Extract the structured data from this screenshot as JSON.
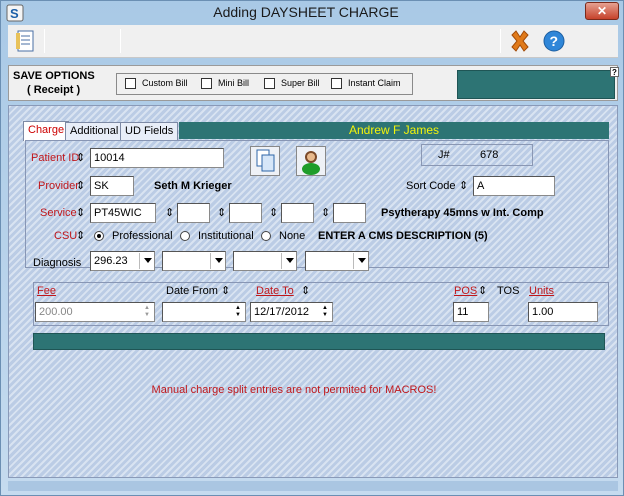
{
  "window": {
    "title": "Adding DAYSHEET CHARGE",
    "close_label": "✕"
  },
  "toolbar": {
    "buttons": [
      "document-icon",
      "cancel-icon",
      "help-icon"
    ]
  },
  "save_options": {
    "title": "SAVE OPTIONS",
    "subtitle": "( Receipt )",
    "checks": [
      {
        "label": "Custom Bill",
        "checked": false
      },
      {
        "label": "Mini Bill",
        "checked": false
      },
      {
        "label": "Super Bill",
        "checked": false
      },
      {
        "label": "Instant Claim",
        "checked": false
      }
    ],
    "help_label": "?"
  },
  "tabs": [
    "Charge",
    "Additional",
    "UD Fields"
  ],
  "patient_name": "Andrew F James",
  "form": {
    "patient_id_label": "Patient ID",
    "patient_id": "10014",
    "j_label": "J#",
    "j_value": "678",
    "provider_label": "Provider",
    "provider_code": "SK",
    "provider_name": "Seth M Krieger",
    "sort_code_label": "Sort Code",
    "sort_code": "A",
    "service_label": "Service",
    "service_code": "PT45WIC",
    "service_desc": "Psytherapy 45mns w Int. Comp",
    "csu_label": "CSU",
    "csu_options": [
      "Professional",
      "Institutional",
      "None"
    ],
    "csu_selected": "Professional",
    "cms_desc": "ENTER A CMS DESCRIPTION (5)",
    "diagnosis_label": "Diagnosis",
    "diagnosis": [
      "296.23",
      "",
      "",
      ""
    ],
    "sort_arrow": "⇕"
  },
  "fee_row": {
    "fee_label": "Fee",
    "fee": "200.00",
    "date_from_label": "Date From",
    "date_from": "",
    "date_to_label": "Date To",
    "date_to": "12/17/2012",
    "pos_label": "POS",
    "pos": "11",
    "tos_label": "TOS",
    "units_label": "Units",
    "units": "1.00"
  },
  "message": "Manual charge split entries are not permited for MACROS!",
  "colors": {
    "teal": "#2d7474",
    "name_text": "#f4f40a",
    "label_red": "#c0171b"
  }
}
